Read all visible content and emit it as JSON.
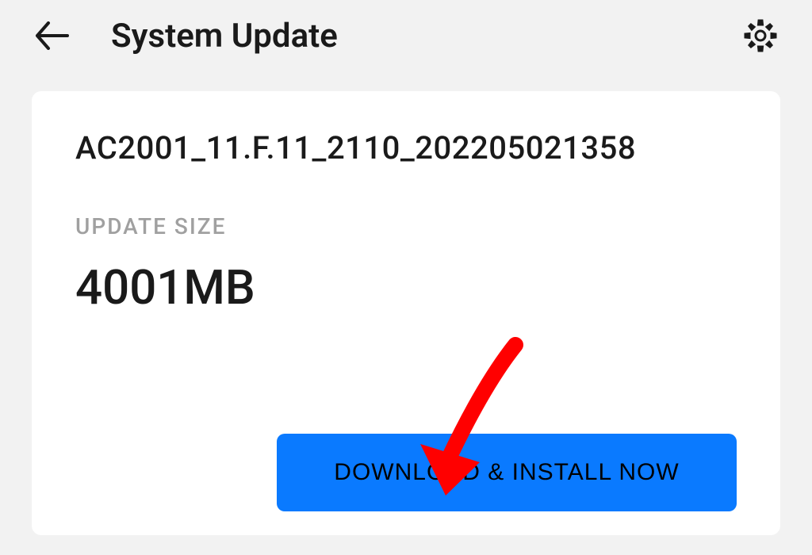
{
  "header": {
    "title": "System Update"
  },
  "update": {
    "version": "AC2001_11.F.11_2110_202205021358",
    "size_label": "UPDATE SIZE",
    "size_value": "4001MB",
    "download_label": "DOWNLOAD & INSTALL NOW"
  },
  "icons": {
    "back": "back-arrow",
    "settings": "gear"
  },
  "colors": {
    "primary_button": "#0a7aff",
    "background": "#f2f2f2",
    "card": "#ffffff",
    "annotation_arrow": "#ff0000"
  }
}
